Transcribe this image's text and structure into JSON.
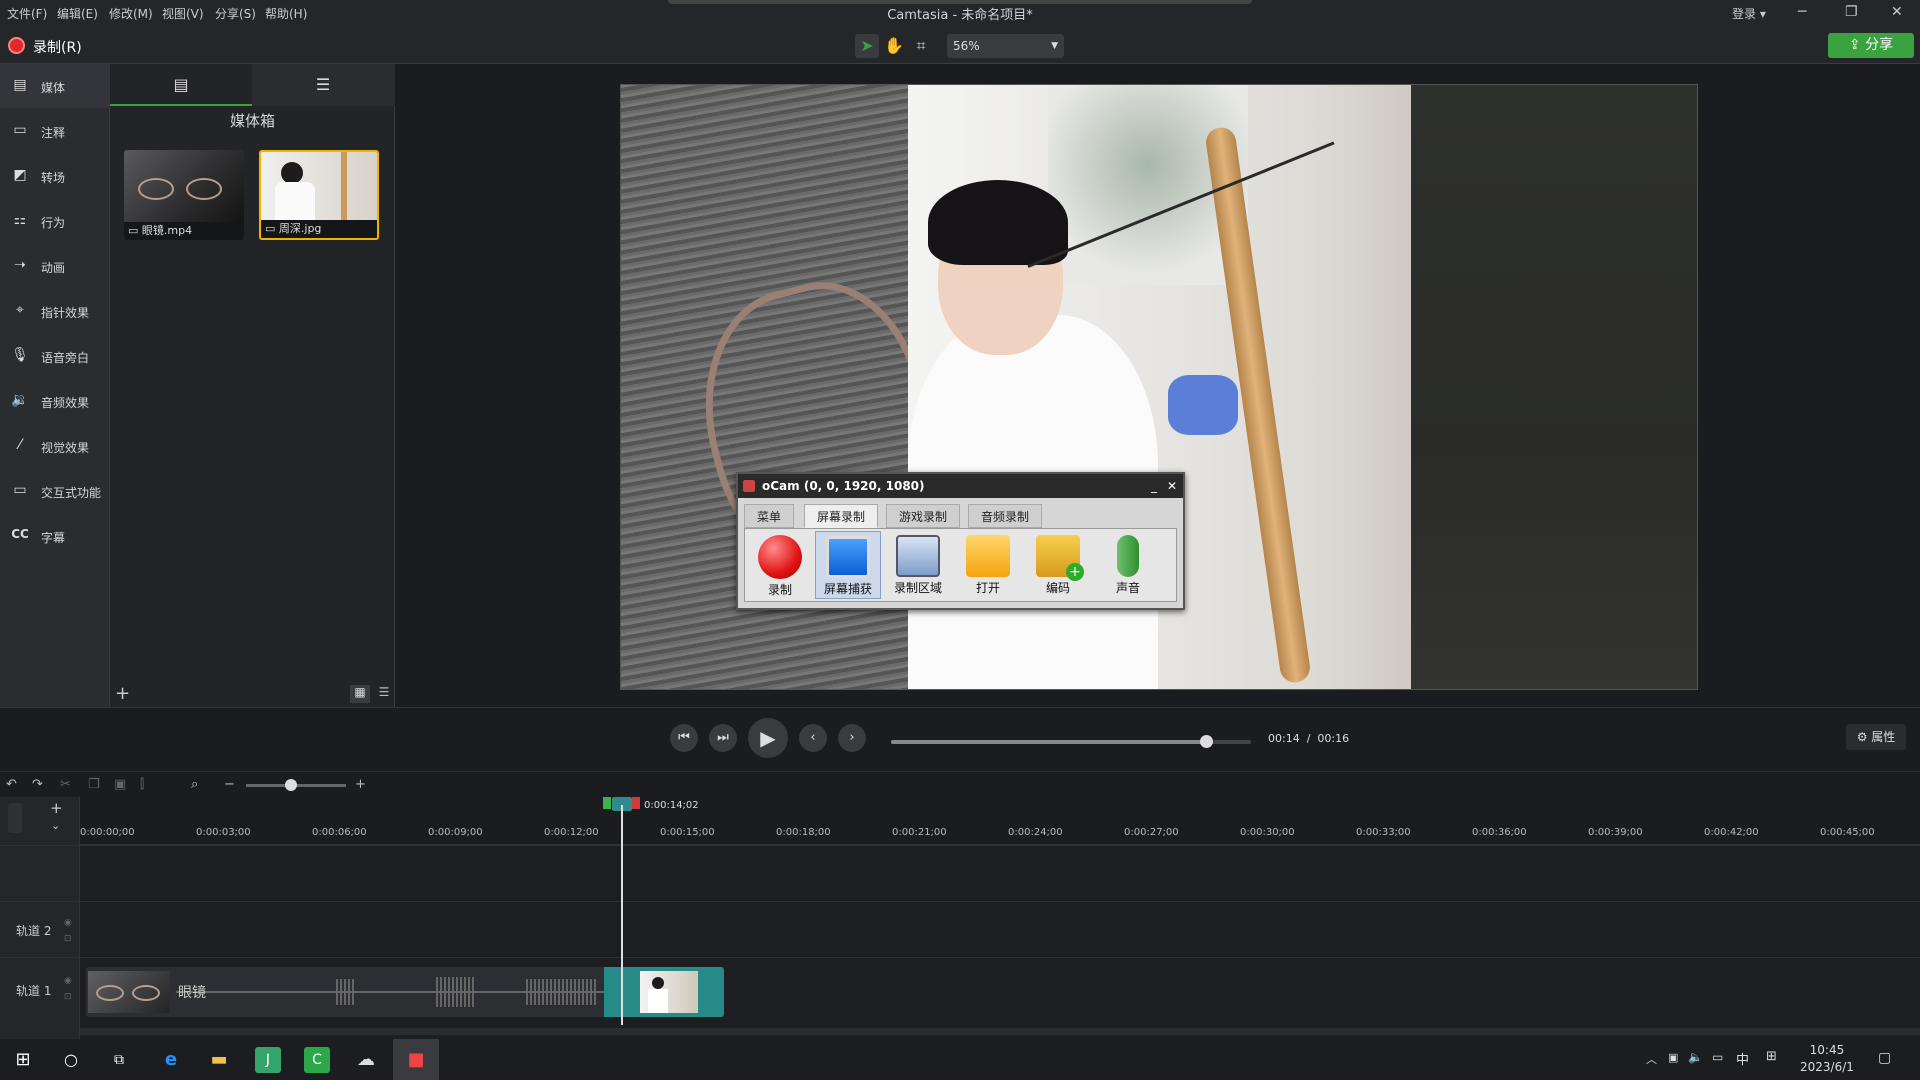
{
  "menubar": {
    "items": [
      "文件(F)",
      "编辑(E)",
      "修改(M)",
      "视图(V)",
      "分享(S)",
      "帮助(H)"
    ],
    "title": "Camtasia - 未命名项目*",
    "login": "登录"
  },
  "toolbar": {
    "record_label": "录制(R)",
    "zoom": "56%",
    "share_label": "分享"
  },
  "sidebar": {
    "items": [
      {
        "label": "媒体",
        "icon": "media-icon"
      },
      {
        "label": "注释",
        "icon": "annotation-icon"
      },
      {
        "label": "转场",
        "icon": "transition-icon"
      },
      {
        "label": "行为",
        "icon": "behavior-icon"
      },
      {
        "label": "动画",
        "icon": "animation-icon"
      },
      {
        "label": "指针效果",
        "icon": "cursor-effect-icon"
      },
      {
        "label": "语音旁白",
        "icon": "microphone-icon"
      },
      {
        "label": "音频效果",
        "icon": "speaker-icon"
      },
      {
        "label": "视觉效果",
        "icon": "wand-icon"
      },
      {
        "label": "交互式功能",
        "icon": "interactive-icon"
      },
      {
        "label": "字幕",
        "icon": "cc-icon"
      }
    ]
  },
  "bin": {
    "title": "媒体箱",
    "items": [
      {
        "label": "眼镜.mp4"
      },
      {
        "label": "周深.jpg"
      }
    ]
  },
  "ocam": {
    "title": "oCam (0, 0, 1920, 1080)",
    "tabs": [
      "菜单",
      "屏幕录制",
      "游戏录制",
      "音频录制"
    ],
    "buttons": [
      {
        "label": "录制"
      },
      {
        "label": "屏幕捕获"
      },
      {
        "label": "录制区域"
      },
      {
        "label": "打开"
      },
      {
        "label": "编码"
      },
      {
        "label": "声音"
      }
    ]
  },
  "playback": {
    "current": "00:14",
    "separator": "/",
    "total": "00:16",
    "progress": 0.875,
    "props_label": "属性"
  },
  "timeline": {
    "playhead_time": "0:00:14;02",
    "ticks": [
      "0:00:00;00",
      "0:00:03;00",
      "0:00:06;00",
      "0:00:09;00",
      "0:00:12;00",
      "0:00:15;00",
      "0:00:18;00",
      "0:00:21;00",
      "0:00:24;00",
      "0:00:27;00",
      "0:00:30;00",
      "0:00:33;00",
      "0:00:36;00",
      "0:00:39;00",
      "0:00:42;00",
      "0:00:45;00"
    ],
    "tracks": [
      "轨道 2",
      "轨道 1"
    ],
    "clip_label": "眼镜",
    "zoom_level": 0.45
  },
  "taskbar": {
    "time": "10:45",
    "date": "2023/6/1",
    "ime": "中"
  },
  "colors": {
    "accent": "#3aa23f",
    "record": "#e0292b",
    "playhead": "#2f8c8a"
  }
}
